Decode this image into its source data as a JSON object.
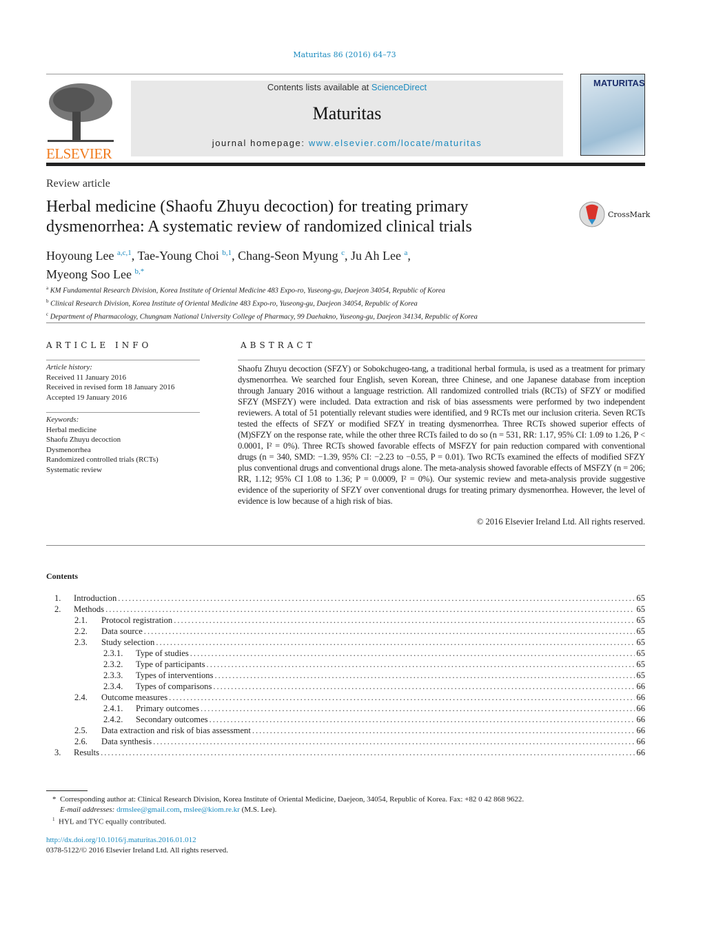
{
  "header": {
    "citation": "Maturitas 86 (2016) 64–73",
    "contents_prefix": "Contents lists available at ",
    "contents_link": "ScienceDirect",
    "journal_name": "Maturitas",
    "homepage_prefix": "journal homepage: ",
    "homepage_link": "www.elsevier.com/locate/maturitas",
    "publisher_logo": "ELSEVIER",
    "cover_title": "MATURITAS"
  },
  "article": {
    "type": "Review article",
    "title": "Herbal medicine (Shaofu Zhuyu decoction) for treating primary dysmenorrhea: A systematic review of randomized clinical trials",
    "crossmark": "CrossMark",
    "authors": [
      {
        "name": "Hoyoung Lee",
        "sup": "a,c,1"
      },
      {
        "name": "Tae-Young Choi",
        "sup": "b,1"
      },
      {
        "name": "Chang-Seon Myung",
        "sup": "c"
      },
      {
        "name": "Ju Ah Lee",
        "sup": "a"
      },
      {
        "name": "Myeong Soo Lee",
        "sup": "b,*"
      }
    ],
    "affiliations": [
      {
        "mark": "a",
        "text": "KM Fundamental Research Division, Korea Institute of Oriental Medicine 483 Expo-ro, Yuseong-gu, Daejeon 34054, Republic of Korea"
      },
      {
        "mark": "b",
        "text": "Clinical Research Division, Korea Institute of Oriental Medicine 483 Expo-ro, Yuseong-gu, Daejeon 34054, Republic of Korea"
      },
      {
        "mark": "c",
        "text": "Department of Pharmacology, Chungnam National University College of Pharmacy, 99 Daehakno, Yuseong-gu, Daejeon 34134, Republic of Korea"
      }
    ]
  },
  "article_info": {
    "heading": "ARTICLE INFO",
    "history_label": "Article history:",
    "history": [
      "Received 11 January 2016",
      "Received in revised form 18 January 2016",
      "Accepted 19 January 2016"
    ],
    "keywords_label": "Keywords:",
    "keywords": [
      "Herbal medicine",
      "Shaofu Zhuyu decoction",
      "Dysmenorrhea",
      "Randomized controlled trials (RCTs)",
      "Systematic review"
    ]
  },
  "abstract": {
    "heading": "ABSTRACT",
    "text": "Shaofu Zhuyu decoction (SFZY) or Sobokchugeo-tang, a traditional herbal formula, is used as a treatment for primary dysmenorrhea. We searched four English, seven Korean, three Chinese, and one Japanese database from inception through January 2016 without a language restriction. All randomized controlled trials (RCTs) of SFZY or modified SFZY (MSFZY) were included. Data extraction and risk of bias assessments were performed by two independent reviewers. A total of 51 potentially relevant studies were identified, and 9 RCTs met our inclusion criteria. Seven RCTs tested the effects of SFZY or modified SFZY in treating dysmenorrhea. Three RCTs showed superior effects of (M)SFZY on the response rate, while the other three RCTs failed to do so (n = 531, RR: 1.17, 95% CI: 1.09 to 1.26, P < 0.0001, I² = 0%). Three RCTs showed favorable effects of MSFZY for pain reduction compared with conventional drugs (n = 340, SMD: −1.39, 95% CI: −2.23 to −0.55, P = 0.01). Two RCTs examined the effects of modified SFZY plus conventional drugs and conventional drugs alone. The meta-analysis showed favorable effects of MSFZY (n = 206; RR, 1.12; 95% CI 1.08 to 1.36; P = 0.0009, I² = 0%). Our systemic review and meta-analysis provide suggestive evidence of the superiority of SFZY over conventional drugs for treating primary dysmenorrhea. However, the level of evidence is low because of a high risk of bias.",
    "copyright": "© 2016 Elsevier Ireland Ltd. All rights reserved."
  },
  "contents": {
    "heading": "Contents",
    "items": [
      {
        "num": "1.",
        "title": "Introduction",
        "page": "65",
        "level": 1
      },
      {
        "num": "2.",
        "title": "Methods",
        "page": "65",
        "level": 1
      },
      {
        "num": "2.1.",
        "title": "Protocol registration",
        "page": "65",
        "level": 2
      },
      {
        "num": "2.2.",
        "title": "Data source",
        "page": "65",
        "level": 2
      },
      {
        "num": "2.3.",
        "title": "Study selection",
        "page": "65",
        "level": 2
      },
      {
        "num": "2.3.1.",
        "title": "Type of studies",
        "page": "65",
        "level": 3
      },
      {
        "num": "2.3.2.",
        "title": "Type of participants",
        "page": "65",
        "level": 3
      },
      {
        "num": "2.3.3.",
        "title": "Types of interventions",
        "page": "65",
        "level": 3
      },
      {
        "num": "2.3.4.",
        "title": "Types of comparisons",
        "page": "66",
        "level": 3
      },
      {
        "num": "2.4.",
        "title": "Outcome measures",
        "page": "66",
        "level": 2
      },
      {
        "num": "2.4.1.",
        "title": "Primary outcomes",
        "page": "66",
        "level": 3
      },
      {
        "num": "2.4.2.",
        "title": "Secondary outcomes",
        "page": "66",
        "level": 3
      },
      {
        "num": "2.5.",
        "title": "Data extraction and risk of bias assessment",
        "page": "66",
        "level": 2
      },
      {
        "num": "2.6.",
        "title": "Data synthesis",
        "page": "66",
        "level": 2
      },
      {
        "num": "3.",
        "title": "Results",
        "page": "66",
        "level": 1
      }
    ]
  },
  "footnotes": {
    "corresponding": "Corresponding author at: Clinical Research Division, Korea Institute of Oriental Medicine, Daejeon, 34054, Republic of Korea. Fax: +82 0 42 868 9622.",
    "email_label": "E-mail addresses:",
    "email1": "drmslee@gmail.com",
    "email2": "mslee@kiom.re.kr",
    "email_suffix": "(M.S. Lee).",
    "equal": "HYL and TYC equally contributed.",
    "star": "*",
    "one": "1"
  },
  "footer": {
    "doi": "http://dx.doi.org/10.1016/j.maturitas.2016.01.012",
    "issn": "0378-5122/© 2016 Elsevier Ireland Ltd. All rights reserved."
  }
}
